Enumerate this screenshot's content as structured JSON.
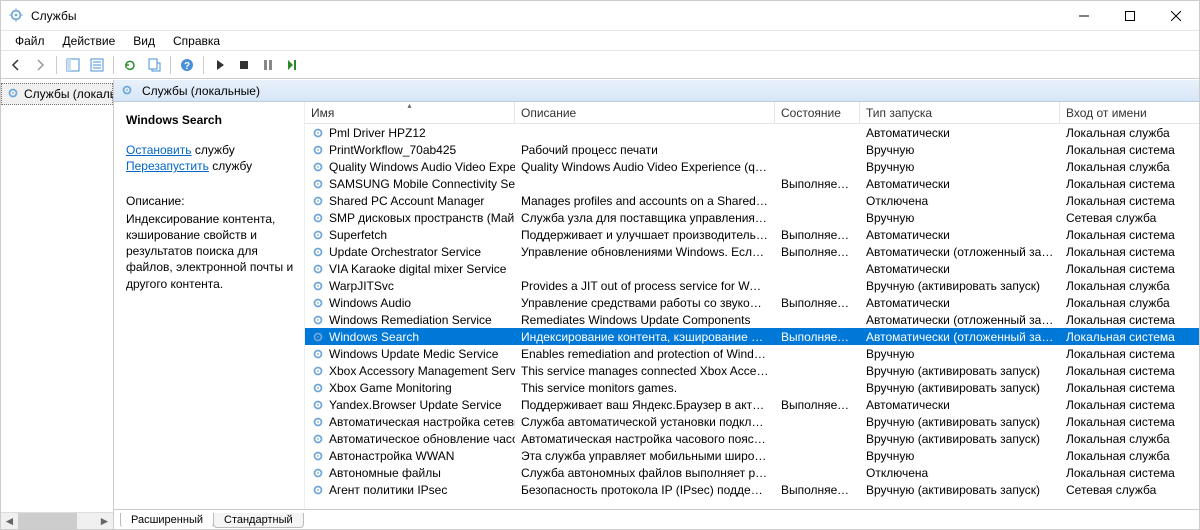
{
  "window": {
    "title": "Службы"
  },
  "menu": {
    "file": "Файл",
    "action": "Действие",
    "view": "Вид",
    "help": "Справка"
  },
  "tree": {
    "root": "Службы (локальн"
  },
  "pane": {
    "header": "Службы (локальные)"
  },
  "info": {
    "service_name": "Windows Search",
    "stop_link": "Остановить",
    "stop_suffix": " службу",
    "restart_link": "Перезапустить",
    "restart_suffix": " службу",
    "desc_label": "Описание:",
    "desc_body": "Индексирование контента, кэширование свойств и результатов поиска для файлов, электронной почты и другого контента."
  },
  "columns": {
    "name": "Имя",
    "description": "Описание",
    "status": "Состояние",
    "startup": "Тип запуска",
    "logon": "Вход от имени"
  },
  "tabs": {
    "extended": "Расширенный",
    "standard": "Стандартный"
  },
  "services": [
    {
      "name": "Pml Driver HPZ12",
      "desc": "",
      "status": "",
      "startup": "Автоматически",
      "logon": "Локальная служба"
    },
    {
      "name": "PrintWorkflow_70ab425",
      "desc": "Рабочий процесс печати",
      "status": "",
      "startup": "Вручную",
      "logon": "Локальная система"
    },
    {
      "name": "Quality Windows Audio Video Experience",
      "desc": "Quality Windows Audio Video Experience (qWave) - с...",
      "status": "",
      "startup": "Вручную",
      "logon": "Локальная служба"
    },
    {
      "name": "SAMSUNG Mobile Connectivity Service",
      "desc": "",
      "status": "Выполняется",
      "startup": "Автоматически",
      "logon": "Локальная система"
    },
    {
      "name": "Shared PC Account Manager",
      "desc": "Manages profiles and accounts on a SharedPC config...",
      "status": "",
      "startup": "Отключена",
      "logon": "Локальная система"
    },
    {
      "name": "SMP дисковых пространств (Майкрос...",
      "desc": "Служба узла для поставщика управления дисковы...",
      "status": "",
      "startup": "Вручную",
      "logon": "Сетевая служба"
    },
    {
      "name": "Superfetch",
      "desc": "Поддерживает и улучшает производительность си...",
      "status": "Выполняется",
      "startup": "Автоматически",
      "logon": "Локальная система"
    },
    {
      "name": "Update Orchestrator Service",
      "desc": "Управление обновлениями Windows. Если она оста...",
      "status": "Выполняется",
      "startup": "Автоматически (отложенный запуск)",
      "logon": "Локальная система"
    },
    {
      "name": "VIA Karaoke digital mixer Service",
      "desc": "",
      "status": "",
      "startup": "Автоматически",
      "logon": "Локальная система"
    },
    {
      "name": "WarpJITSvc",
      "desc": "Provides a JIT out of process service for WARP when r...",
      "status": "",
      "startup": "Вручную (активировать запуск)",
      "logon": "Локальная служба"
    },
    {
      "name": "Windows Audio",
      "desc": "Управление средствами работы со звуком для про...",
      "status": "Выполняется",
      "startup": "Автоматически",
      "logon": "Локальная служба"
    },
    {
      "name": "Windows Remediation Service",
      "desc": "Remediates Windows Update Components",
      "status": "",
      "startup": "Автоматически (отложенный запуск)",
      "logon": "Локальная система"
    },
    {
      "name": "Windows Search",
      "desc": "Индексирование контента, кэширование свойств ...",
      "status": "Выполняется",
      "startup": "Автоматически (отложенный запуск)",
      "logon": "Локальная система",
      "selected": true
    },
    {
      "name": "Windows Update Medic Service",
      "desc": "Enables remediation and protection of Windows Upd...",
      "status": "",
      "startup": "Вручную",
      "logon": "Локальная система"
    },
    {
      "name": "Xbox Accessory Management Service",
      "desc": "This service manages connected Xbox Accessories.",
      "status": "",
      "startup": "Вручную (активировать запуск)",
      "logon": "Локальная система"
    },
    {
      "name": "Xbox Game Monitoring",
      "desc": "This service monitors games.",
      "status": "",
      "startup": "Вручную (активировать запуск)",
      "logon": "Локальная система"
    },
    {
      "name": "Yandex.Browser Update Service",
      "desc": "Поддерживает ваш Яндекс.Браузер в актуальном с...",
      "status": "Выполняется",
      "startup": "Автоматически",
      "logon": "Локальная система"
    },
    {
      "name": "Автоматическая настройка сетевых ...",
      "desc": "Служба автоматической установки подключений...",
      "status": "",
      "startup": "Вручную (активировать запуск)",
      "logon": "Локальная система"
    },
    {
      "name": "Автоматическое обновление часово...",
      "desc": "Автоматическая настройка часового пояса для си...",
      "status": "",
      "startup": "Вручную (активировать запуск)",
      "logon": "Локальная служба"
    },
    {
      "name": "Автонастройка WWAN",
      "desc": "Эта служба управляет мобильными широкополос...",
      "status": "",
      "startup": "Вручную",
      "logon": "Локальная служба"
    },
    {
      "name": "Автономные файлы",
      "desc": "Служба автономных файлов выполняет работу по...",
      "status": "",
      "startup": "Отключена",
      "logon": "Локальная система"
    },
    {
      "name": "Агент политики IPsec",
      "desc": "Безопасность протокола IP (IPsec) поддерживает п...",
      "status": "Выполняется",
      "startup": "Вручную (активировать запуск)",
      "logon": "Сетевая служба"
    }
  ]
}
